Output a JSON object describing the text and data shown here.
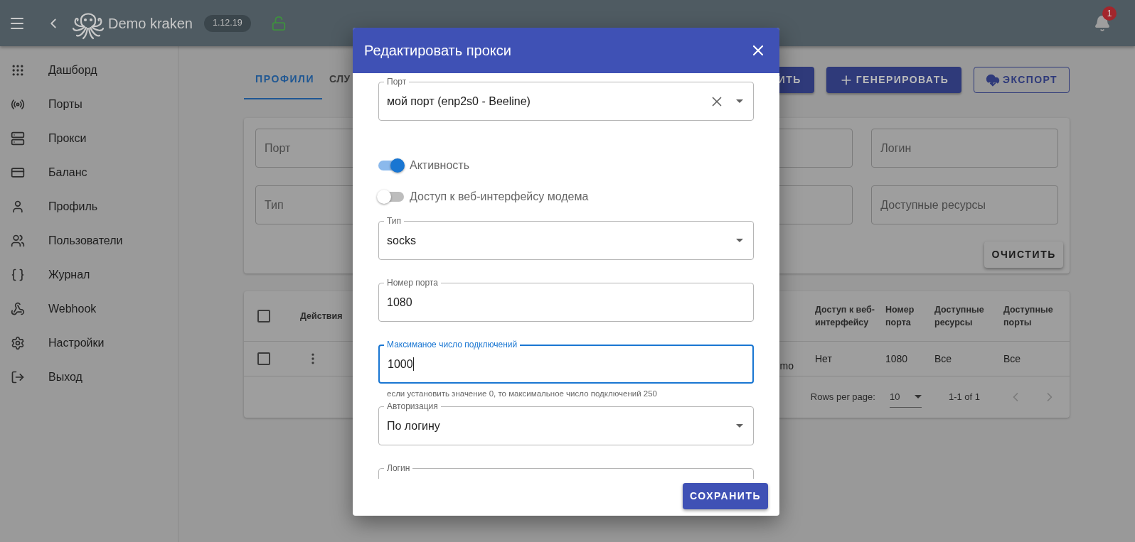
{
  "app_bar": {
    "title": "Demo kraken",
    "version": "1.12.19",
    "notifications": "1"
  },
  "sidebar": {
    "items": [
      "Дашборд",
      "Порты",
      "Прокси",
      "Баланс",
      "Профиль",
      "Пользователи",
      "Журнал",
      "Webhook",
      "Настройки",
      "Выход"
    ]
  },
  "tabs": [
    {
      "label": "ПРОФИЛИ",
      "selected": true
    },
    {
      "label": "СЛУ",
      "selected": false
    }
  ],
  "actions": [
    {
      "label": "ИТЬ",
      "kind": "contained"
    },
    {
      "label": "ГЕНЕРИРОВАТЬ",
      "kind": "contained"
    },
    {
      "label": "ЭКСПОРТ",
      "kind": "outlined"
    }
  ],
  "filters": {
    "fields": [
      {
        "placeholder": "Порт"
      },
      {
        "placeholder": "Логин"
      },
      {
        "placeholder": "Тип"
      },
      {
        "placeholder": "Доступные ресурсы"
      }
    ],
    "clear_button": "ОЧИСТИТЬ"
  },
  "table": {
    "header_checked": false,
    "columns": [
      "Действия",
      "Доступ к веб-интерфейсу",
      "Номер порта",
      "Доступные ресурсы",
      "Доступные порты"
    ],
    "rows": [
      {
        "checked": false,
        "cells": [
          "mo",
          "Нет",
          "1080",
          "Все",
          "Все"
        ]
      }
    ],
    "pagination": {
      "rows_per_page_label": "Rows per page:",
      "rows_per_page": "10",
      "range": "1-1 of 1"
    }
  },
  "dialog": {
    "title": "Редактировать прокси",
    "save": "СОХРАНИТЬ",
    "items": [
      {
        "kind": "select",
        "label": "Порт",
        "value": "мой порт (enp2s0 - Beeline)",
        "clearable": true
      },
      {
        "kind": "switch",
        "label": "Активность",
        "on": true
      },
      {
        "kind": "switch",
        "label": "Доступ к веб-интерфейсу модема",
        "on": false
      },
      {
        "kind": "select",
        "label": "Тип",
        "value": "socks",
        "clearable": false
      },
      {
        "kind": "text",
        "label": "Номер порта",
        "value": "1080",
        "focused": false
      },
      {
        "kind": "text",
        "label": "Максиманое число подключений",
        "value": "1000",
        "focused": true,
        "helper": "если установить значение 0, то максимальное число подключений 250"
      },
      {
        "kind": "select",
        "label": "Авторизация",
        "value": "По логину",
        "clearable": false
      },
      {
        "kind": "text",
        "label": "Логин",
        "focused": false
      }
    ]
  }
}
